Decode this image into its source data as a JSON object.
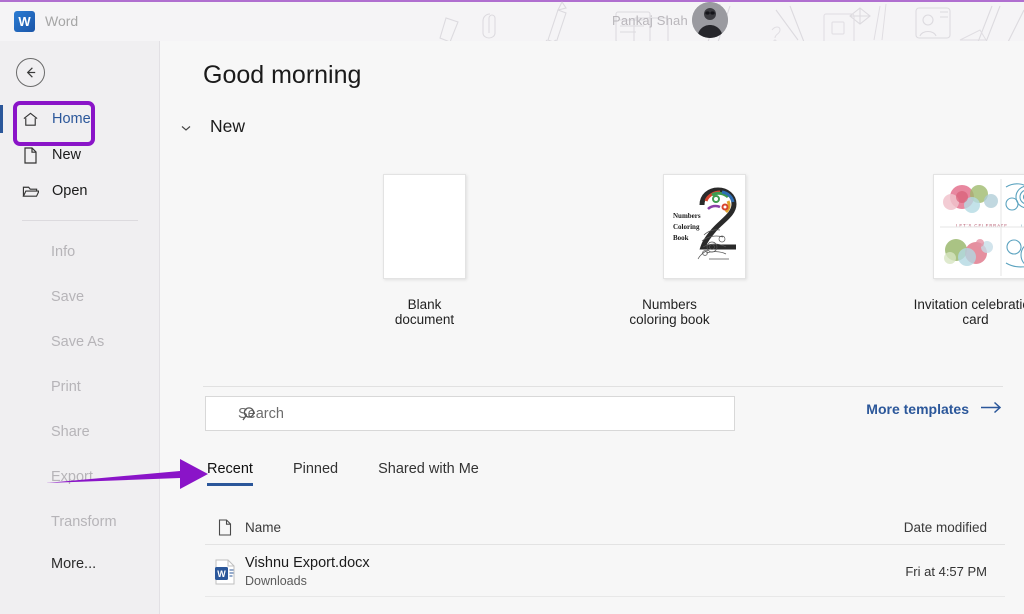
{
  "header": {
    "app_name": "Word",
    "logo_letter": "W",
    "account_name": "Pankaj Shah",
    "decorations": [
      "paperclip-outline",
      "pencil-outline",
      "cards-outline",
      "diamond-outline",
      "contact-card-outline",
      "ribbon-outline",
      "device-outline",
      "page-outline"
    ]
  },
  "sidebar": {
    "back_label": "Back",
    "primary_items": [
      {
        "label": "Home",
        "icon": "home-icon",
        "active": true
      },
      {
        "label": "New",
        "icon": "new-document-icon",
        "active": false
      },
      {
        "label": "Open",
        "icon": "open-folder-icon",
        "active": false
      }
    ],
    "secondary_items": [
      {
        "label": "Info",
        "disabled": true
      },
      {
        "label": "Save",
        "disabled": true
      },
      {
        "label": "Save As",
        "disabled": true
      },
      {
        "label": "Print",
        "disabled": true
      },
      {
        "label": "Share",
        "disabled": true
      },
      {
        "label": "Export",
        "disabled": true
      },
      {
        "label": "Transform",
        "disabled": true
      },
      {
        "label": "More...",
        "disabled": false
      }
    ]
  },
  "main": {
    "greeting": "Good morning",
    "new_section": {
      "title": "New",
      "chevron": "chevron-down-icon"
    },
    "templates": [
      {
        "label": "Blank document",
        "thumb": "blank-page"
      },
      {
        "label": "Numbers coloring book",
        "thumb": "coloring-number-2",
        "thumb_text": [
          "Numbers",
          "Coloring",
          "Book"
        ],
        "thumb_number": "2"
      },
      {
        "label": "Invitation celebration card",
        "thumb": "invitation-grid",
        "thumb_text": "LET'S CELEBRATE"
      }
    ],
    "more_templates": {
      "label": "More templates",
      "icon": "arrow-right-icon"
    },
    "search": {
      "placeholder": "Search",
      "value": "",
      "icon": "search-icon"
    },
    "tabs": [
      {
        "label": "Recent",
        "active": true
      },
      {
        "label": "Pinned",
        "active": false
      },
      {
        "label": "Shared with Me",
        "active": false
      }
    ],
    "file_list": {
      "columns": {
        "icon": "document-icon",
        "name": "Name",
        "date": "Date modified"
      },
      "rows": [
        {
          "icon": "word-file-icon",
          "name": "Vishnu Export.docx",
          "location": "Downloads",
          "date_modified": "Fri at 4:57 PM"
        }
      ]
    }
  },
  "annotations": {
    "highlight_box": {
      "target": "Home",
      "color": "#8a14c8"
    },
    "arrow": {
      "target": "Recent",
      "color": "#8a14c8",
      "direction": "right"
    }
  },
  "colors": {
    "accent_blue": "#2b579a",
    "annotation_purple": "#8a14c8",
    "header_line": "#b06fd0",
    "sidebar_bg": "#f0eff1",
    "main_bg": "#f7f7f7"
  }
}
